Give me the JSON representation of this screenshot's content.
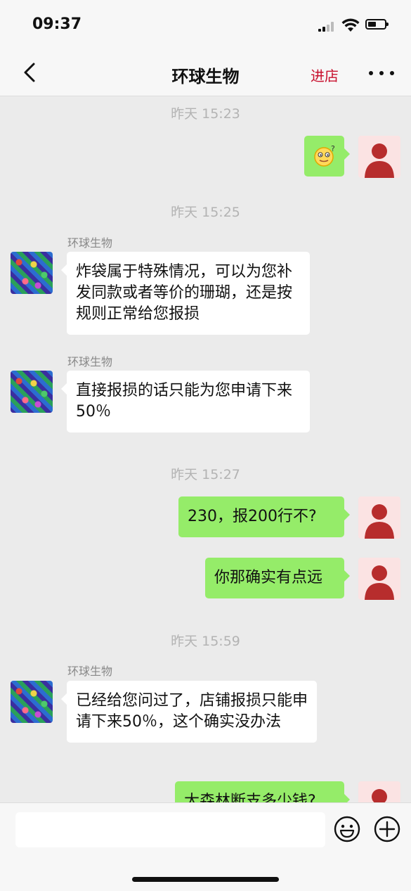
{
  "status_bar": {
    "time": "09:37"
  },
  "nav": {
    "title": "环球生物",
    "enter_store": "进店"
  },
  "messages": [
    {
      "timestamp": "昨天 15:23"
    },
    {
      "timestamp": "昨天 15:25"
    },
    {
      "sender": "环球生物",
      "text": "炸袋属于特殊情况，可以为您补发同款或者等价的珊瑚，还是按规则正常给您报损"
    },
    {
      "sender": "环球生物",
      "text": "直接报损的话只能为您申请下来50％"
    },
    {
      "timestamp": "昨天 15:27"
    },
    {
      "text": "230，报200行不?"
    },
    {
      "text": "你那确实有点远"
    },
    {
      "timestamp": "昨天 15:59"
    },
    {
      "sender": "环球生物",
      "text": "已经给您问过了，店铺报损只能申请下来50％，这个确实没办法"
    },
    {
      "text": "大森林断支多少钱?"
    }
  ],
  "icons": {
    "back": "chevron-left-icon",
    "more": "more-icon",
    "emoji": "emoji-icon",
    "add": "plus-icon",
    "avatar_me": "person-icon"
  },
  "colors": {
    "background": "#ebebeb",
    "outgoing_bubble": "#95ec69",
    "incoming_bubble": "#ffffff",
    "accent_red": "#c8102e",
    "avatar_red": "#b72d2d"
  }
}
